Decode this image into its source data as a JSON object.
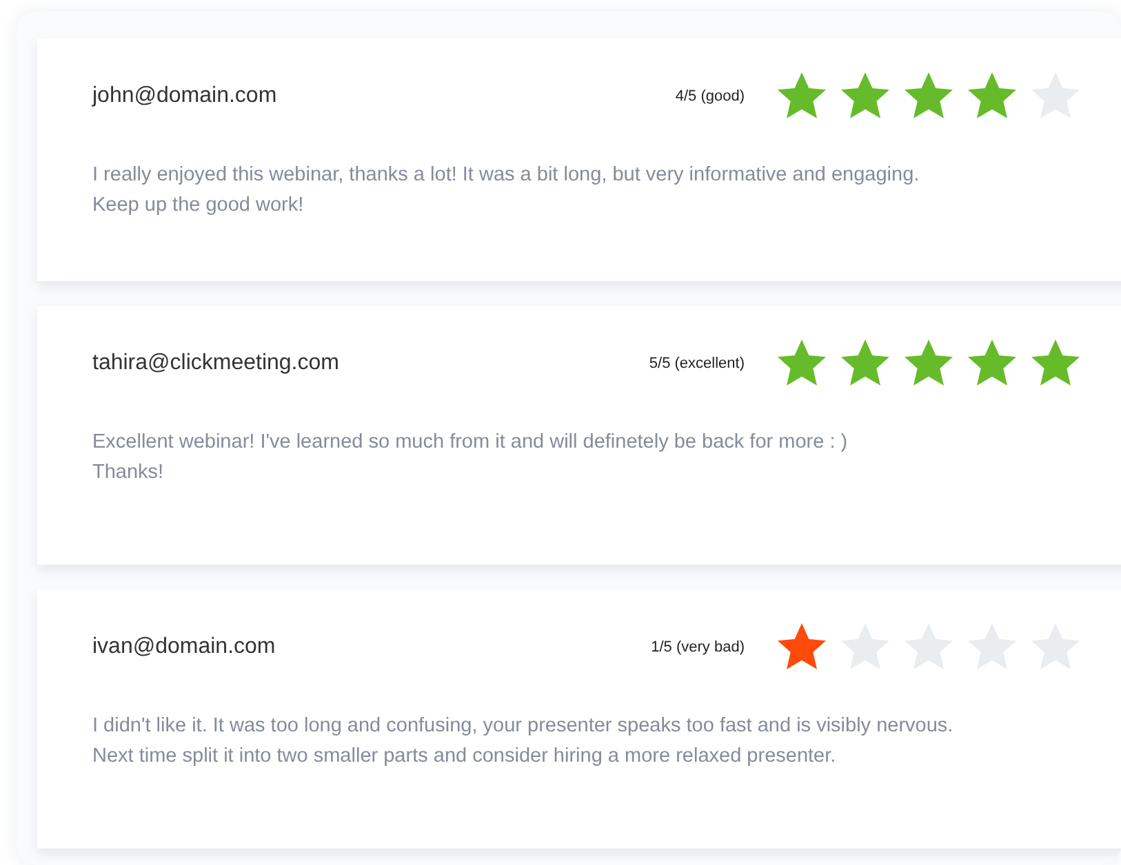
{
  "reviews": [
    {
      "email": "john@domain.com",
      "rating_label": "4/5 (good)",
      "stars": 4,
      "color": "#66bb2a",
      "comment": "I really enjoyed this webinar, thanks a lot! It was a bit long, but very informative and engaging.\nKeep up the good work!"
    },
    {
      "email": "tahira@clickmeeting.com",
      "rating_label": "5/5 (excellent)",
      "stars": 5,
      "color": "#66bb2a",
      "comment": "Excellent webinar! I've learned so much from it and will definetely be back for more : )\nThanks!"
    },
    {
      "email": "ivan@domain.com",
      "rating_label": "1/5 (very bad)",
      "stars": 1,
      "color": "#ff4a0a",
      "comment": "I didn't like it. It was too long and confusing, your presenter speaks too fast and is visibly nervous.\nNext time split it into two smaller parts and consider hiring a more relaxed presenter."
    }
  ]
}
